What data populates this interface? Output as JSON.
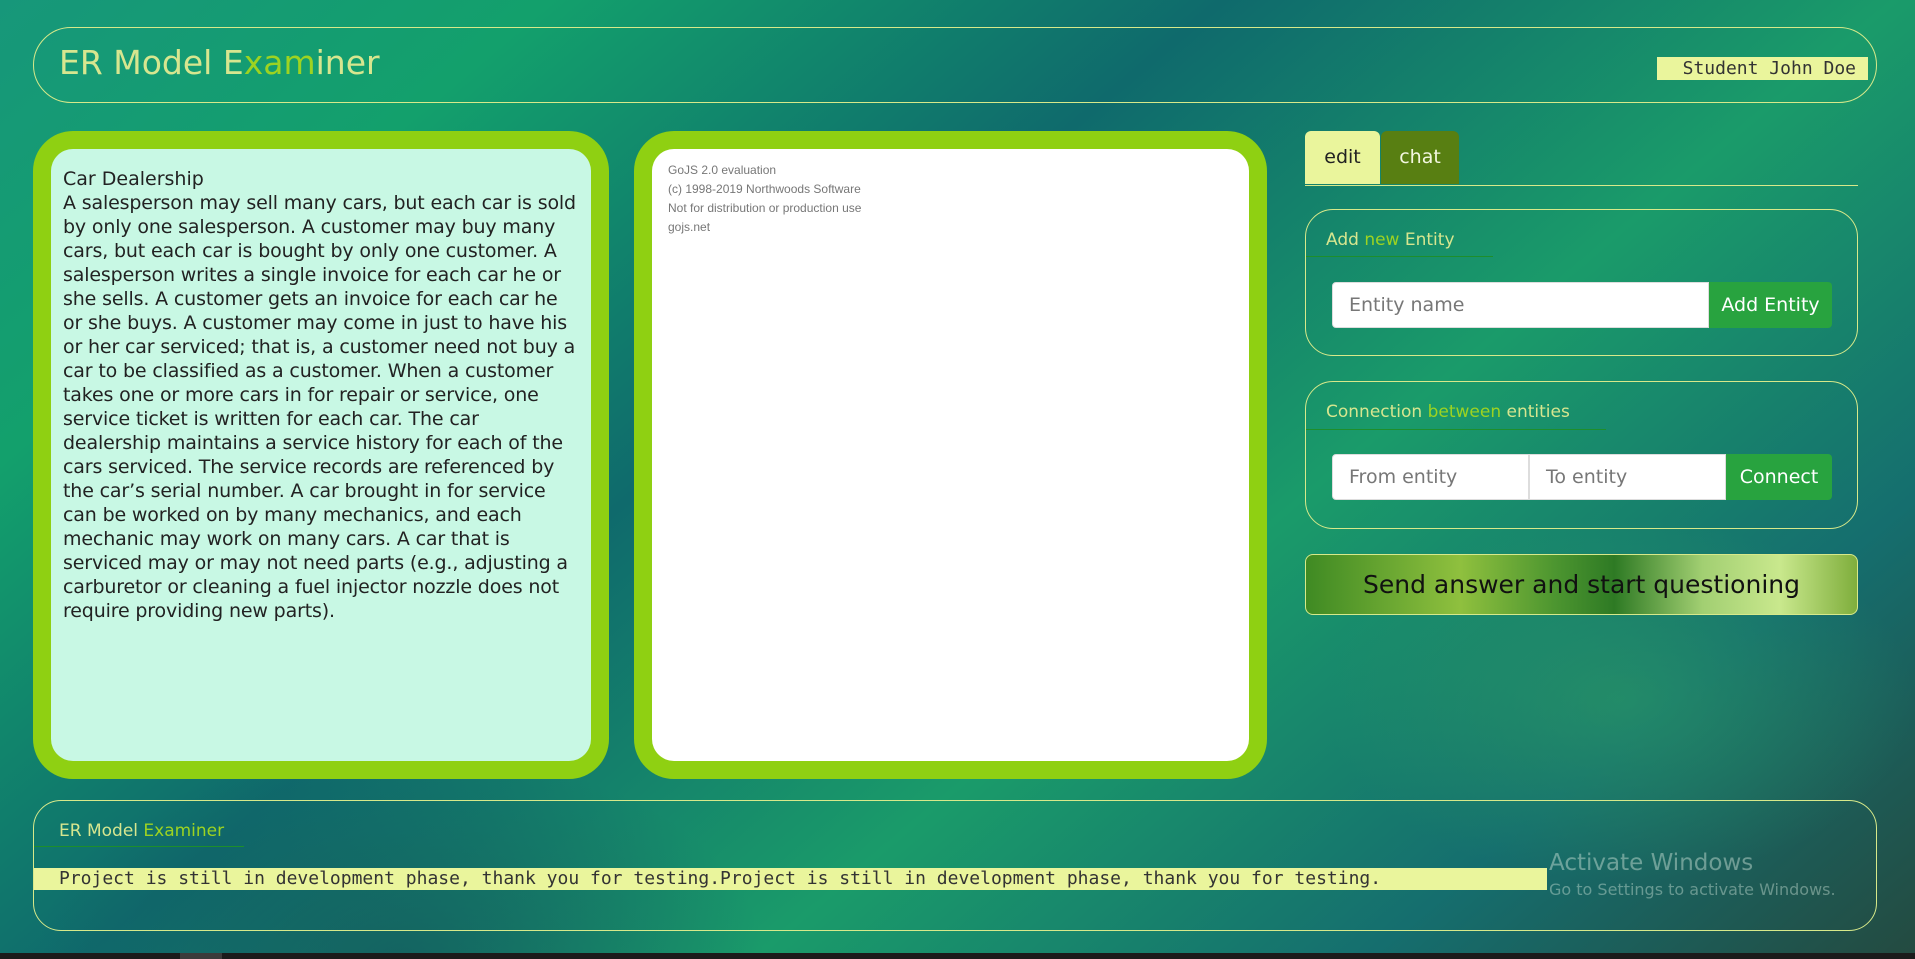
{
  "header": {
    "title_a": "ER Model E",
    "title_b": "xam",
    "title_c": "iner",
    "user": "Student John Doe"
  },
  "task": {
    "title": "Car Dealership",
    "description": "A salesperson may sell many cars, but each car is sold by only one salesperson. A customer may buy many cars, but each car is bought by only one customer. A salesperson writes a single invoice for each car he or she sells. A customer gets an invoice for each car he or she buys. A customer may come in just to have his or her car serviced; that is, a customer need not buy a car to be classified as a customer. When a customer takes one or more cars in for repair or service, one service ticket is written for each car. The car dealership maintains a service history for each of the cars serviced. The service records are referenced by the car’s serial number. A car brought in for service can be worked on by many mechanics, and each mechanic may work on many cars. A car that is serviced may or may not need parts (e.g., adjusting a carburetor or cleaning a fuel injector nozzle does not require providing new parts)."
  },
  "diagram": {
    "watermark": [
      "GoJS 2.0 evaluation",
      "(c) 1998-2019 Northwoods Software",
      "Not for distribution or production use",
      "gojs.net"
    ]
  },
  "tabs": [
    {
      "label": "edit",
      "active": true
    },
    {
      "label": "chat",
      "active": false
    }
  ],
  "add_entity": {
    "legend_a": "Add ",
    "legend_b": "new",
    "legend_c": " Entity",
    "placeholder": "Entity name",
    "button": "Add Entity"
  },
  "connection": {
    "legend_a": "Connection ",
    "legend_b": "between",
    "legend_c": " entities",
    "from_placeholder": "From entity",
    "to_placeholder": "To entity",
    "button": "Connect"
  },
  "send_button": "Send answer and start questioning",
  "footer": {
    "title_a": "ER Model ",
    "title_b": "Examiner",
    "marquee": "Project is still in development phase, thank you for testing.Project is still in development phase, thank you for testing."
  },
  "windows": {
    "title": "Activate Windows",
    "subtitle": "Go to Settings to activate Windows."
  },
  "colors": {
    "accent_yellow": "#eaf59c",
    "panel_green": "#8fd012",
    "button_green": "#28a33f",
    "chat_tab": "#587f12"
  }
}
